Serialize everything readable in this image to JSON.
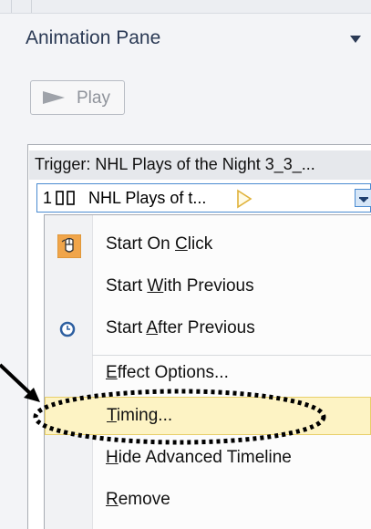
{
  "pane": {
    "title": "Animation Pane"
  },
  "play": {
    "label": "Play"
  },
  "trigger": {
    "text": "Trigger: NHL Plays of the Night 3_3_..."
  },
  "animation_item": {
    "order": "1",
    "name": "NHL Plays of t..."
  },
  "context_menu": {
    "items": [
      {
        "pre": "Start On ",
        "u": "C",
        "post": "lick"
      },
      {
        "pre": "Start ",
        "u": "W",
        "post": "ith Previous"
      },
      {
        "pre": "Start ",
        "u": "A",
        "post": "fter Previous"
      },
      {
        "pre": "",
        "u": "E",
        "post": "ffect Options..."
      },
      {
        "pre": "",
        "u": "T",
        "post": "iming..."
      },
      {
        "pre": "",
        "u": "H",
        "post": "ide Advanced Timeline"
      },
      {
        "pre": "",
        "u": "R",
        "post": "emove"
      }
    ]
  },
  "colors": {
    "hover_fill": "#fdf3c4",
    "selection_border": "#4a8bd1",
    "click_icon_bg": "#f0a54a"
  }
}
